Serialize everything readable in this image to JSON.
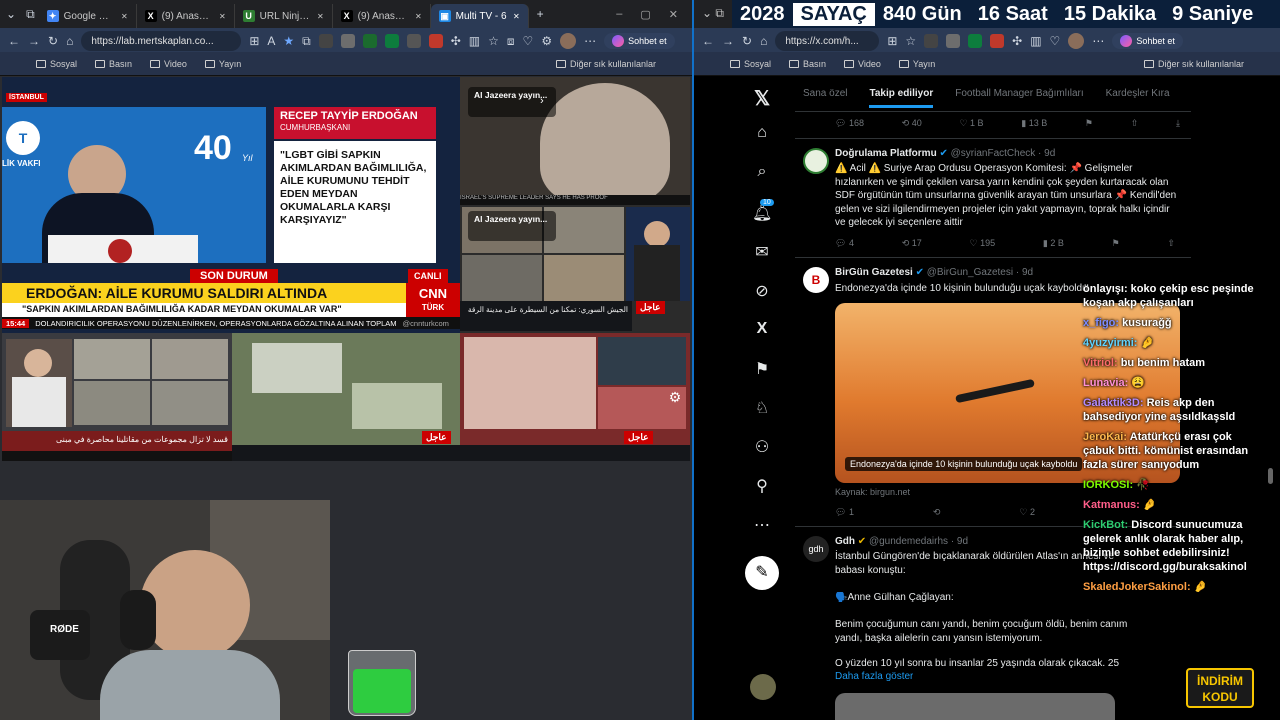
{
  "left_browser": {
    "tabs": [
      {
        "label": "Google Gemini",
        "color": "#4285f4",
        "glyph": "✦"
      },
      {
        "label": "(9) Anasayfa / X",
        "color": "#000",
        "glyph": "X"
      },
      {
        "label": "URL Ninja (14)",
        "color": "#2e7d32",
        "glyph": "U"
      },
      {
        "label": "(9) Anasayfa / X",
        "color": "#000",
        "glyph": "X"
      },
      {
        "label": "Multi TV - 6",
        "color": "#1e88e5",
        "glyph": "▣"
      }
    ],
    "url": "https://lab.mertskaplan.co...",
    "chat_label": "Sohbet et",
    "bookmarks": [
      "Sosyal",
      "Basın",
      "Video",
      "Yayın"
    ],
    "other_bookmarks": "Diğer sık kullanılanlar"
  },
  "right_browser": {
    "url": "https://x.com/h...",
    "chat_label": "Sohbet et",
    "bookmarks": [
      "Sosyal",
      "Basın",
      "Video",
      "Yayın"
    ],
    "other_bookmarks": "Diğer sık kullanılanlar"
  },
  "countdown": {
    "year": "2028",
    "label": "SAYAÇ",
    "days": "840 Gün",
    "hours": "16 Saat",
    "minutes": "15 Dakika",
    "seconds": "9 Saniye"
  },
  "tv": {
    "istanbul": "İSTANBUL",
    "speaker_name": "RECEP TAYYİP ERDOĞAN",
    "speaker_title": "CUMHURBAŞKANI",
    "quote": "\"LGBT GİBİ SAPKIN AKIMLARDAN BAĞIMLILIĞA, AİLE KURUMUNU TEHDİT EDEN MEYDAN OKUMALARLA KARŞI KARŞIYAYIZ\"",
    "logo_40": "40",
    "logo_year": "Yıl",
    "vakfi": "LİK VAKFI",
    "son_durum": "SON DURUM",
    "canli": "CANLI",
    "headline": "ERDOĞAN: AİLE KURUMU SALDIRI ALTINDA",
    "subheadline": "\"SAPKIN AKIMLARDAN BAĞIMLILIĞA KADAR MEYDAN OKUMALAR VAR\"",
    "time": "15:44",
    "ticker": "DOLANDIRICILIK OPERASYONU DÜZENLENİRKEN, OPERASYONLARDA GÖZALTINA ALINAN TOPLAM",
    "cnn_handle": "@cnnturkcom",
    "cnn": "CNN",
    "turk": "TÜRK",
    "aj1": "Al Jazeera yayın...",
    "aj2": "Al Jazeera yayın...",
    "ajil": "عاجل",
    "arabic_ticker": "الجيش السوري: تمكنا من السيطرة على مدينة الرقة",
    "arabic_sub": "قسد لا تزال مجموعات من مقاتلينا محاصرة في مبنى"
  },
  "x": {
    "tabs": [
      "Sana özel",
      "Takip ediliyor",
      "Football Manager Bağımlıları",
      "Kardeşler Kıra"
    ],
    "notif_count": "10",
    "first_actions": [
      "168",
      "40",
      "1 B",
      "13 B"
    ],
    "posts": [
      {
        "name": "Doğrulama Platformu",
        "handle": "@syrianFactCheck · 9d",
        "text": "⚠️ Acil ⚠️ Suriye Arap Ordusu Operasyon Komitesi: 📌 Gelişmeler hızlanırken ve şimdi çekilen varsa yarın kendini çok şeyden kurtaracak olan SDF örgütünün tüm unsurlarına güvenlik arayan tüm unsurlara 📌 Kendil'den gelen ve sizi ilgilendirmeyen projeler için yakıt yapmayın, toprak halkı içindir ve gelecek iyi seçenlere aittir",
        "actions": [
          "4",
          "17",
          "195",
          "2 B"
        ]
      },
      {
        "name": "BirGün Gazetesi",
        "handle": "@BirGun_Gazetesi · 9d",
        "text": "Endonezya'da içinde 10 kişinin bulunduğu uçak kayboldu",
        "caption": "Endonezya'da içinde 10 kişinin bulunduğu uçak kayboldu",
        "source": "Kaynak: birgun.net",
        "actions": [
          "1",
          "",
          "2",
          ""
        ]
      },
      {
        "name": "Gdh",
        "handle": "@gundemedairhs · 9d",
        "lines": [
          "İstanbul Güngören'de bıçaklanarak öldürülen Atlas'ın annesi ve babası konuştu:",
          "🗣️Anne Gülhan Çağlayan:",
          "Benim çocuğumun canı yandı, benim çocuğum öldü, benim canım yandı, başka ailelerin canı yansın istemiyorum.",
          "O yüzden 10 yıl sonra bu insanlar 25 yaşında olarak çıkacak. 25"
        ],
        "more": "Daha fazla göster"
      }
    ]
  },
  "chat": [
    {
      "user": "",
      "text": "önlayışı: koko çekip esc peşinde koşan akp çalışanları",
      "color": "#fff"
    },
    {
      "user": "x_figo:",
      "text": "kusuraǧǧ",
      "color": "#7b8cff"
    },
    {
      "user": "4yuzyirmi:",
      "text": "🤌",
      "color": "#5fd3ff"
    },
    {
      "user": "Vitriol:",
      "text": "bu benim hatam",
      "color": "#ff6b6b"
    },
    {
      "user": "Lunavia:",
      "text": "😩",
      "color": "#ff8fd4"
    },
    {
      "user": "Galaktik3D:",
      "text": "Reis akp den bahsediyor yine aşsıldkaşsld",
      "color": "#b18bff"
    },
    {
      "user": "JeroKai:",
      "text": "Atatürkçü erası çok çabuk bitti. kömünist erasından fazla sürer sanıyodum",
      "color": "#ffb84d"
    },
    {
      "user": "IORKOSI:",
      "text": "🥀",
      "color": "#7CFC00"
    },
    {
      "user": "Katmanus:",
      "text": "🤌",
      "color": "#ff5e8a"
    },
    {
      "user": "KickBot:",
      "text": "Discord sunucumuza gelerek anlık olarak haber alıp, bizimle sohbet edebilirsiniz! https://discord.gg/buraksakinol",
      "color": "#2ecc71"
    },
    {
      "user": "SkaledJokerSakinol:",
      "text": "🤌",
      "color": "#ff9f43"
    }
  ],
  "indirim": {
    "line1": "İNDİRİM",
    "line2": "KODU"
  },
  "rode": "RØDE"
}
